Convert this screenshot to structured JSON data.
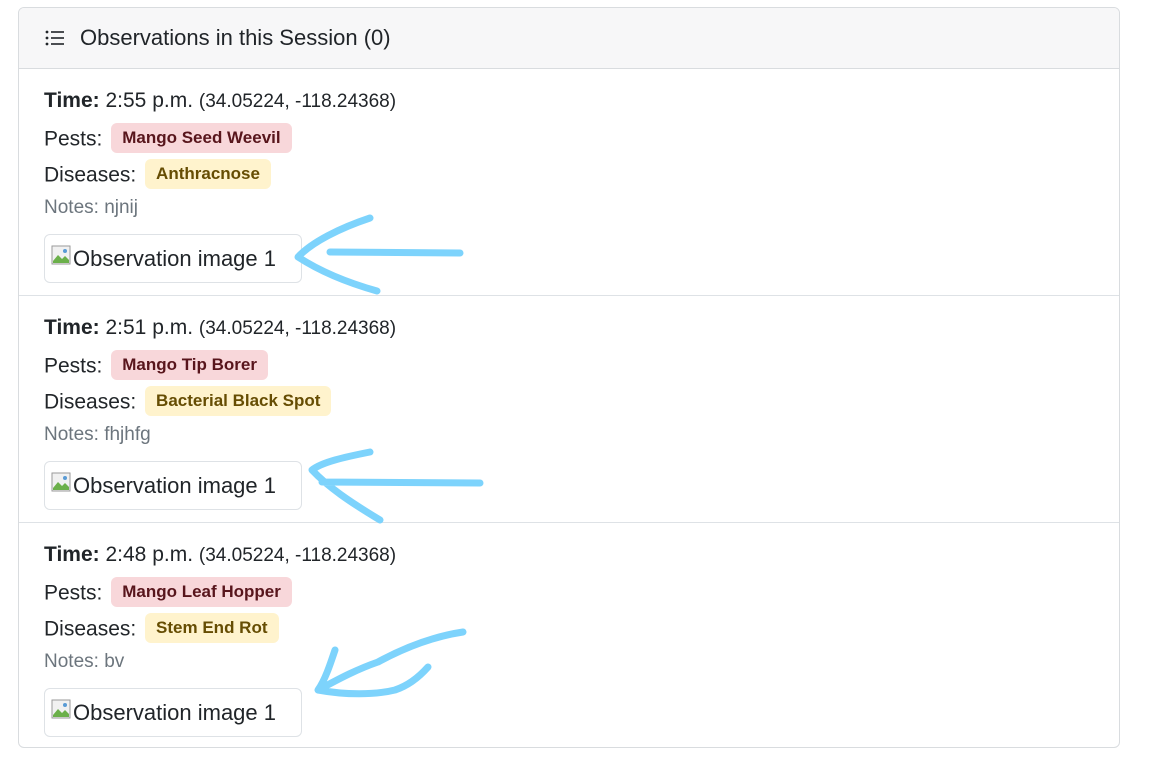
{
  "header": {
    "title": "Observations in this Session (0)",
    "icon": "list-icon"
  },
  "observations": [
    {
      "time_label": "Time:",
      "time": "2:55 p.m.",
      "coords": "(34.05224, -118.24368)",
      "pests_label": "Pests:",
      "pest": "Mango Seed Weevil",
      "diseases_label": "Diseases:",
      "disease": "Anthracnose",
      "notes": "Notes: njnij",
      "image_alt": "Observation image 1"
    },
    {
      "time_label": "Time:",
      "time": "2:51 p.m.",
      "coords": "(34.05224, -118.24368)",
      "pests_label": "Pests:",
      "pest": "Mango Tip Borer",
      "diseases_label": "Diseases:",
      "disease": "Bacterial Black Spot",
      "notes": "Notes: fhjhfg",
      "image_alt": "Observation image 1"
    },
    {
      "time_label": "Time:",
      "time": "2:48 p.m.",
      "coords": "(34.05224, -118.24368)",
      "pests_label": "Pests:",
      "pest": "Mango Leaf Hopper",
      "diseases_label": "Diseases:",
      "disease": "Stem End Rot",
      "notes": "Notes: bv",
      "image_alt": "Observation image 1"
    }
  ],
  "colors": {
    "pest_badge_bg": "#f8d7da",
    "pest_badge_text": "#58151c",
    "disease_badge_bg": "#fff3cd",
    "disease_badge_text": "#664d03",
    "annotation_arrow": "#7dd3fc"
  }
}
